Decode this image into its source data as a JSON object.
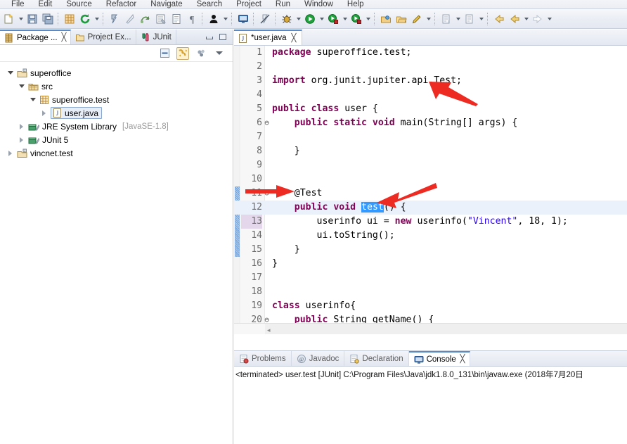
{
  "menubar": {
    "items": [
      "File",
      "Edit",
      "Source",
      "Refactor",
      "Navigate",
      "Search",
      "Project",
      "Run",
      "Window",
      "Help"
    ]
  },
  "toolbar": {
    "groups": [
      {
        "items": [
          {
            "name": "new-wizard-icon",
            "arrow": true
          },
          {
            "name": "save-icon",
            "arrow": false
          },
          {
            "name": "save-all-icon",
            "arrow": false
          }
        ]
      },
      {
        "items": [
          {
            "name": "new-java-package-icon",
            "arrow": false
          },
          {
            "name": "refresh-icon",
            "arrow": true
          }
        ]
      },
      {
        "items": [
          {
            "name": "toggle-breakpoint-icon",
            "arrow": false
          },
          {
            "name": "skip-breakpoints-icon",
            "arrow": false
          },
          {
            "name": "step-return-icon",
            "arrow": false
          },
          {
            "name": "open-type-icon",
            "arrow": false
          },
          {
            "name": "open-task-icon",
            "arrow": false
          },
          {
            "name": "pilcrow-icon",
            "arrow": false
          }
        ]
      },
      {
        "items": [
          {
            "name": "debug-perspective-icon",
            "arrow": true
          }
        ]
      },
      {
        "items": [
          {
            "name": "open-console-icon",
            "arrow": false
          }
        ]
      },
      {
        "items": [
          {
            "name": "skip-all-breakpoints-icon",
            "arrow": false
          }
        ]
      },
      {
        "items": [
          {
            "name": "debug-icon",
            "arrow": true
          },
          {
            "name": "run-icon",
            "arrow": true
          },
          {
            "name": "coverage-icon",
            "arrow": true
          },
          {
            "name": "external-tools-icon",
            "arrow": true
          }
        ]
      },
      {
        "items": [
          {
            "name": "open-package-icon",
            "arrow": false
          },
          {
            "name": "open-folder-icon",
            "arrow": false
          },
          {
            "name": "search-pencil-icon",
            "arrow": true
          }
        ]
      },
      {
        "items": [
          {
            "name": "next-annotation-icon",
            "arrow": true
          },
          {
            "name": "previous-annotation-icon",
            "arrow": true
          }
        ]
      },
      {
        "items": [
          {
            "name": "back-icon",
            "arrow": false
          },
          {
            "name": "forward-back-icon",
            "arrow": true
          },
          {
            "name": "forward-icon",
            "arrow": true
          }
        ]
      }
    ]
  },
  "left_panel": {
    "tabs": [
      {
        "label": "Package ...",
        "icon": "package-explorer-icon",
        "active": true,
        "closable": true
      },
      {
        "label": "Project Ex...",
        "icon": "project-explorer-icon",
        "active": false,
        "closable": false
      },
      {
        "label": "JUnit",
        "icon": "junit-icon",
        "active": false,
        "closable": false
      }
    ],
    "window_buttons": [
      "minimize-button",
      "maximize-button"
    ],
    "view_toolbar": [
      {
        "name": "collapse-all-button",
        "toggled": false
      },
      {
        "name": "link-with-editor-button",
        "toggled": true
      },
      {
        "name": "focus-on-active-task-button",
        "toggled": false
      },
      {
        "name": "view-menu-button",
        "toggled": false
      }
    ],
    "tree": [
      {
        "indent": 0,
        "twist": "open",
        "icon": "java-project-icon",
        "label": "superoffice",
        "suffix": "",
        "selected": false
      },
      {
        "indent": 1,
        "twist": "open",
        "icon": "source-folder-icon",
        "label": "src",
        "suffix": "",
        "selected": false
      },
      {
        "indent": 2,
        "twist": "open",
        "icon": "package-icon",
        "label": "superoffice.test",
        "suffix": "",
        "selected": false
      },
      {
        "indent": 3,
        "twist": "closed",
        "icon": "java-file-icon",
        "label": "user.java",
        "suffix": "",
        "selected": true
      },
      {
        "indent": 1,
        "twist": "closed",
        "icon": "library-icon",
        "label": "JRE System Library",
        "suffix": "[JavaSE-1.8]",
        "selected": false
      },
      {
        "indent": 1,
        "twist": "closed",
        "icon": "library-icon",
        "label": "JUnit 5",
        "suffix": "",
        "selected": false
      },
      {
        "indent": 0,
        "twist": "closed",
        "icon": "java-project-icon",
        "label": "vincnet.test",
        "suffix": "",
        "selected": false
      }
    ]
  },
  "editor": {
    "tab": {
      "label": "*user.java",
      "icon": "java-file-icon",
      "dirty": true,
      "close": "╳"
    },
    "lines": [
      {
        "no": "1",
        "fold": "",
        "highlight_line": false,
        "highlight_num": false,
        "marker": false,
        "tokens": [
          {
            "t": "package",
            "c": "kw"
          },
          {
            "t": " superoffice.test;",
            "c": "plain"
          }
        ]
      },
      {
        "no": "2",
        "fold": "",
        "highlight_line": false,
        "highlight_num": false,
        "marker": false,
        "tokens": []
      },
      {
        "no": "3",
        "fold": "",
        "highlight_line": false,
        "highlight_num": false,
        "marker": false,
        "tokens": [
          {
            "t": "import",
            "c": "kw"
          },
          {
            "t": " org.junit.jupiter.api.Test;",
            "c": "plain"
          }
        ]
      },
      {
        "no": "4",
        "fold": "",
        "highlight_line": false,
        "highlight_num": false,
        "marker": false,
        "tokens": []
      },
      {
        "no": "5",
        "fold": "",
        "highlight_line": false,
        "highlight_num": false,
        "marker": false,
        "tokens": [
          {
            "t": "public class",
            "c": "kw"
          },
          {
            "t": " user {",
            "c": "plain"
          }
        ]
      },
      {
        "no": "6",
        "fold": "⊖",
        "highlight_line": false,
        "highlight_num": false,
        "marker": false,
        "tokens": [
          {
            "t": "    ",
            "c": "plain"
          },
          {
            "t": "public static void",
            "c": "kw"
          },
          {
            "t": " main(String[] args) {",
            "c": "plain"
          }
        ]
      },
      {
        "no": "7",
        "fold": "",
        "highlight_line": false,
        "highlight_num": false,
        "marker": false,
        "tokens": []
      },
      {
        "no": "8",
        "fold": "",
        "highlight_line": false,
        "highlight_num": false,
        "marker": false,
        "tokens": [
          {
            "t": "    }",
            "c": "plain"
          }
        ]
      },
      {
        "no": "9",
        "fold": "",
        "highlight_line": false,
        "highlight_num": false,
        "marker": false,
        "tokens": []
      },
      {
        "no": "10",
        "fold": "",
        "highlight_line": false,
        "highlight_num": false,
        "marker": false,
        "tokens": []
      },
      {
        "no": "11",
        "fold": "⊖",
        "highlight_line": false,
        "highlight_num": false,
        "marker": true,
        "tokens": [
          {
            "t": "    @Test",
            "c": "plain"
          }
        ]
      },
      {
        "no": "12",
        "fold": "",
        "highlight_line": true,
        "highlight_num": false,
        "marker": true,
        "tokens": [
          {
            "t": "    ",
            "c": "plain"
          },
          {
            "t": "public void",
            "c": "kw"
          },
          {
            "t": " ",
            "c": "plain"
          },
          {
            "t": "test",
            "c": "sel"
          },
          {
            "t": "() {",
            "c": "plain"
          }
        ]
      },
      {
        "no": "13",
        "fold": "",
        "highlight_line": false,
        "highlight_num": true,
        "marker": true,
        "tokens": [
          {
            "t": "        userinfo ui = ",
            "c": "plain"
          },
          {
            "t": "new",
            "c": "kw"
          },
          {
            "t": " userinfo(",
            "c": "plain"
          },
          {
            "t": "\"Vincent\"",
            "c": "str"
          },
          {
            "t": ", 18, 1);",
            "c": "plain"
          }
        ]
      },
      {
        "no": "14",
        "fold": "",
        "highlight_line": false,
        "highlight_num": false,
        "marker": true,
        "tokens": [
          {
            "t": "        ui.toString();",
            "c": "plain"
          }
        ]
      },
      {
        "no": "15",
        "fold": "",
        "highlight_line": false,
        "highlight_num": false,
        "marker": true,
        "tokens": [
          {
            "t": "    }",
            "c": "plain"
          }
        ]
      },
      {
        "no": "16",
        "fold": "",
        "highlight_line": false,
        "highlight_num": false,
        "marker": false,
        "tokens": [
          {
            "t": "}",
            "c": "plain"
          }
        ]
      },
      {
        "no": "17",
        "fold": "",
        "highlight_line": false,
        "highlight_num": false,
        "marker": false,
        "tokens": []
      },
      {
        "no": "18",
        "fold": "",
        "highlight_line": false,
        "highlight_num": false,
        "marker": false,
        "tokens": []
      },
      {
        "no": "19",
        "fold": "",
        "highlight_line": false,
        "highlight_num": false,
        "marker": false,
        "tokens": [
          {
            "t": "class",
            "c": "kw"
          },
          {
            "t": " userinfo{",
            "c": "plain"
          }
        ]
      },
      {
        "no": "20",
        "fold": "⊖",
        "highlight_line": false,
        "highlight_num": false,
        "marker": false,
        "tokens": [
          {
            "t": "    ",
            "c": "plain"
          },
          {
            "t": "public",
            "c": "kw"
          },
          {
            "t": " String getName() {",
            "c": "plain"
          }
        ]
      }
    ],
    "scroll_arrow": "◂"
  },
  "bottom_panel": {
    "tabs": [
      {
        "label": "Problems",
        "icon": "problems-icon",
        "active": false,
        "closable": false
      },
      {
        "label": "Javadoc",
        "icon": "javadoc-icon",
        "active": false,
        "closable": false
      },
      {
        "label": "Declaration",
        "icon": "declaration-icon",
        "active": false,
        "closable": false
      },
      {
        "label": "Console",
        "icon": "console-icon",
        "active": true,
        "closable": true
      }
    ],
    "console_text": "<terminated> user.test [JUnit] C:\\Program Files\\Java\\jdk1.8.0_131\\bin\\javaw.exe (2018年7月20日"
  },
  "annotations": [
    {
      "name": "red-arrow-import-line",
      "color": "#ee2b22"
    },
    {
      "name": "red-arrow-test-annotation",
      "color": "#ee2b22"
    },
    {
      "name": "red-arrow-test-method",
      "color": "#ee2b22"
    }
  ],
  "colors": {
    "accent": "#5a8ac6",
    "keyword": "#7f0055",
    "string": "#2a00ff",
    "selection": "#3399ff",
    "current_line": "#eaf1fb",
    "annotation_arrow": "#ee2b22"
  }
}
